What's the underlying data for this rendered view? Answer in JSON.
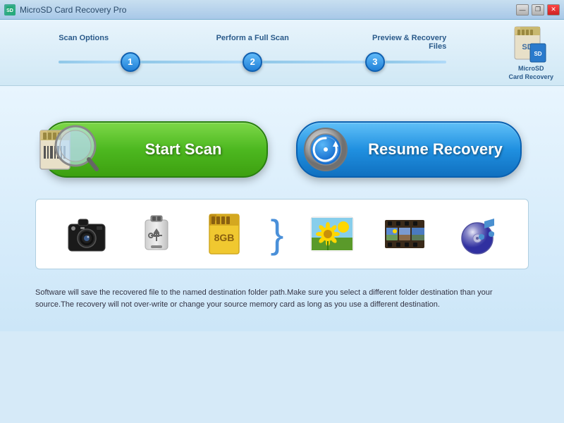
{
  "window": {
    "title": "MicroSD Card Recovery Pro",
    "controls": {
      "minimize": "—",
      "restore": "❐",
      "close": "✕"
    }
  },
  "steps": [
    {
      "label": "Scan Options",
      "number": "1"
    },
    {
      "label": "Perform a Full Scan",
      "number": "2"
    },
    {
      "label": "Preview & Recovery Files",
      "number": "3"
    }
  ],
  "logo": {
    "line1": "MicroSD",
    "line2": "Card Recovery"
  },
  "buttons": {
    "start_scan": "Start Scan",
    "resume_recovery": "Resume Recovery"
  },
  "footer": "Software will save the recovered file to the named destination folder path.Make sure you select a different folder destination than your source.The recovery will not over-write or change your source memory card as long as you use a different destination."
}
